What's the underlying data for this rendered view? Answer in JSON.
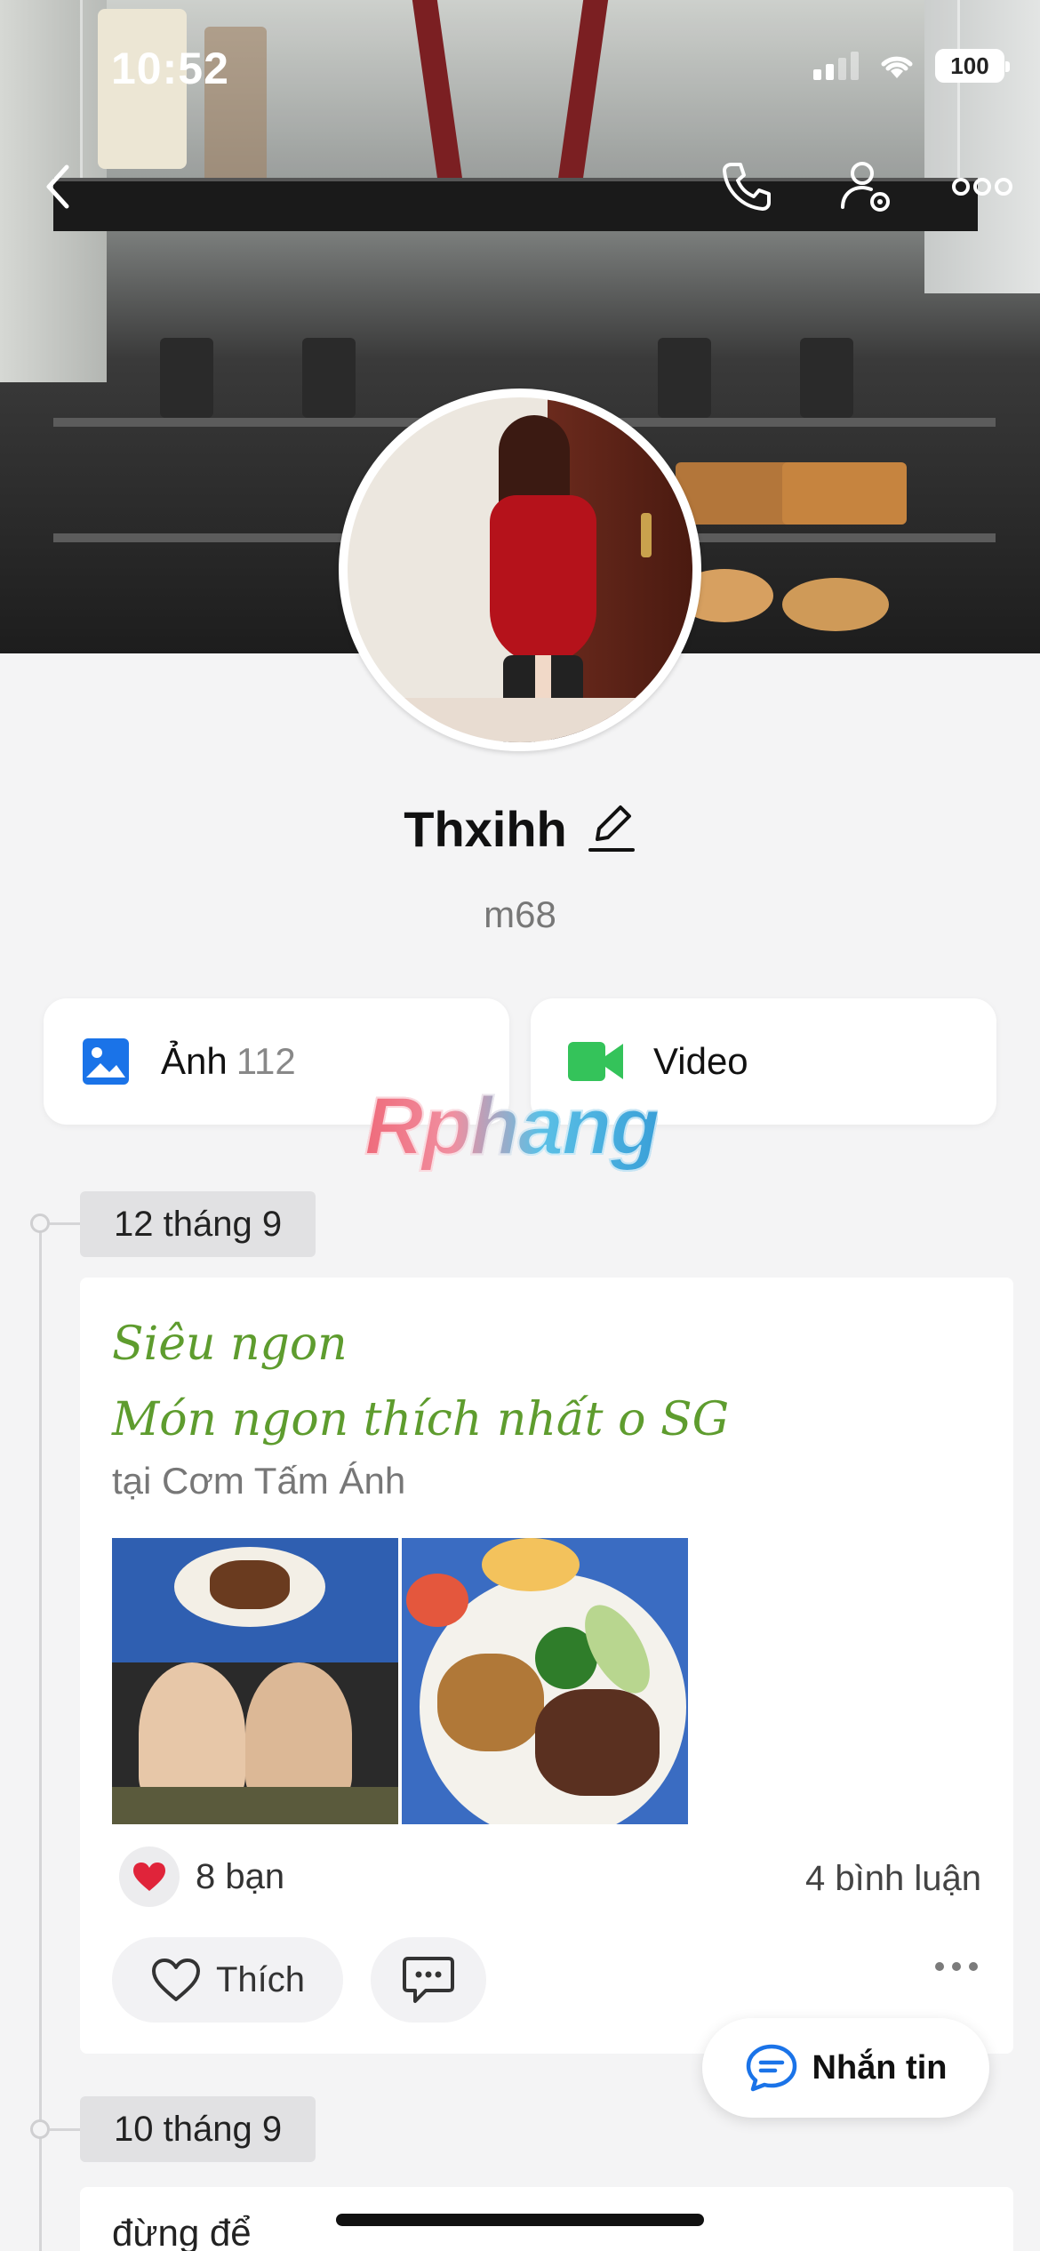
{
  "status_bar": {
    "time": "10:52",
    "battery": "100"
  },
  "profile": {
    "name": "Thxihh",
    "bio": "m68"
  },
  "media": {
    "photos": {
      "label": "Ảnh",
      "count": "112"
    },
    "videos": {
      "label": "Video"
    }
  },
  "watermark": "Rphang",
  "timeline": [
    {
      "date": "12 tháng 9",
      "post": {
        "lines": [
          "Siêu ngon",
          "Món ngon thích nhất o SG"
        ],
        "location": "tại Cơm Tấm Ánh",
        "reactions": "8 bạn",
        "comments": "4 bình luận",
        "like_label": "Thích"
      }
    },
    {
      "date": "10 tháng 9",
      "post": {
        "text": "đừng để"
      }
    }
  ],
  "message_button": "Nhắn tin",
  "colors": {
    "accent_blue": "#1a73e8",
    "video_green": "#34c35a",
    "post_text_green": "#5e9c2e",
    "heart_red": "#e0243a"
  },
  "icons": [
    "back-icon",
    "phone-icon",
    "profile-settings-icon",
    "more-icon",
    "edit-icon",
    "photo-icon",
    "video-icon",
    "heart-icon",
    "comment-icon",
    "message-icon"
  ]
}
